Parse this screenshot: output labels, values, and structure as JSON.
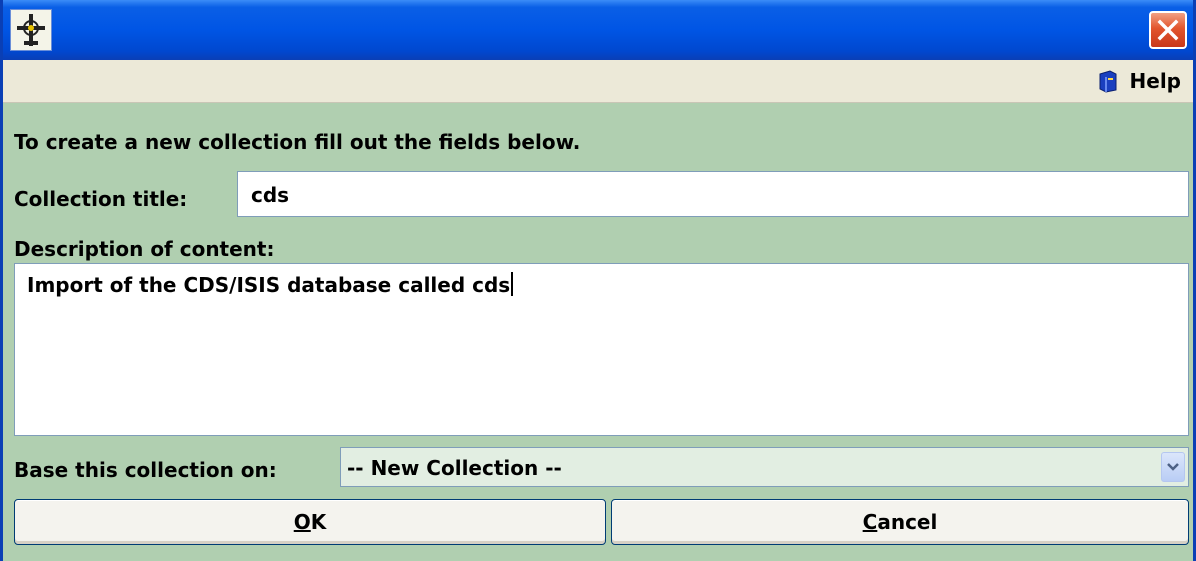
{
  "help": {
    "label": "Help",
    "icon": "help-book-icon"
  },
  "form": {
    "instructions": "To create a new collection fill out the fields below.",
    "title_label": "Collection title:",
    "title_value": "cds",
    "description_label": "Description of content:",
    "description_value": "Import of the CDS/ISIS database called cds",
    "base_label": "Base this collection on:",
    "base_selected": "-- New Collection --"
  },
  "buttons": {
    "ok": {
      "mnemonic": "O",
      "rest": "K"
    },
    "cancel": {
      "mnemonic": "C",
      "rest": "ancel"
    }
  },
  "colors": {
    "titlebar": "#0055e5",
    "panel": "#b0cfb0",
    "menubar": "#ece9d8"
  }
}
